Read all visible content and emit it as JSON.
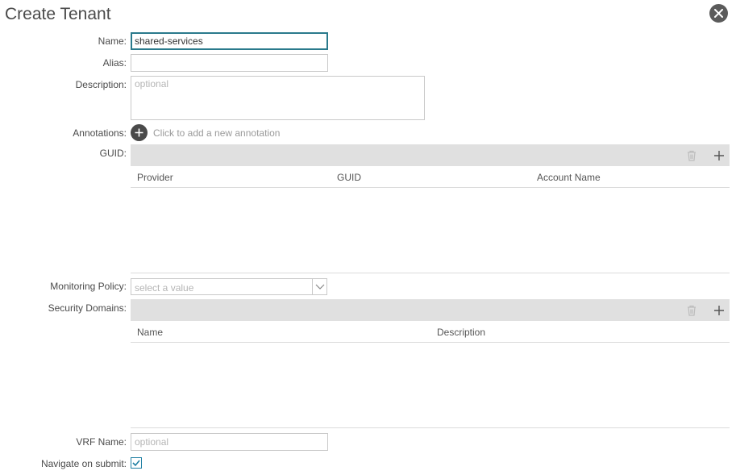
{
  "dialog": {
    "title": "Create Tenant"
  },
  "icons": {
    "close": "close-icon",
    "add": "plus-circle-icon",
    "delete": "trash-icon",
    "plus": "plus-icon",
    "chevron": "chevron-down-icon",
    "check": "checkmark-icon"
  },
  "form": {
    "name": {
      "label": "Name:",
      "value": "shared-services"
    },
    "alias": {
      "label": "Alias:",
      "value": ""
    },
    "description": {
      "label": "Description:",
      "placeholder": "optional"
    },
    "annotations": {
      "label": "Annotations:",
      "hint": "Click to add a new annotation"
    },
    "guid": {
      "label": "GUID:",
      "columns": [
        "Provider",
        "GUID",
        "Account Name"
      ]
    },
    "monitoring_policy": {
      "label": "Monitoring Policy:",
      "placeholder": "select a value"
    },
    "security_domains": {
      "label": "Security Domains:",
      "columns": [
        "Name",
        "Description"
      ]
    },
    "vrf_name": {
      "label": "VRF Name:",
      "placeholder": "optional"
    },
    "navigate_on_submit": {
      "label": "Navigate on submit:",
      "checked": true
    }
  },
  "colors": {
    "accent": "#1f7fa3",
    "toolbar": "#e0e0e0",
    "dark_icon": "#4a4a4a"
  }
}
